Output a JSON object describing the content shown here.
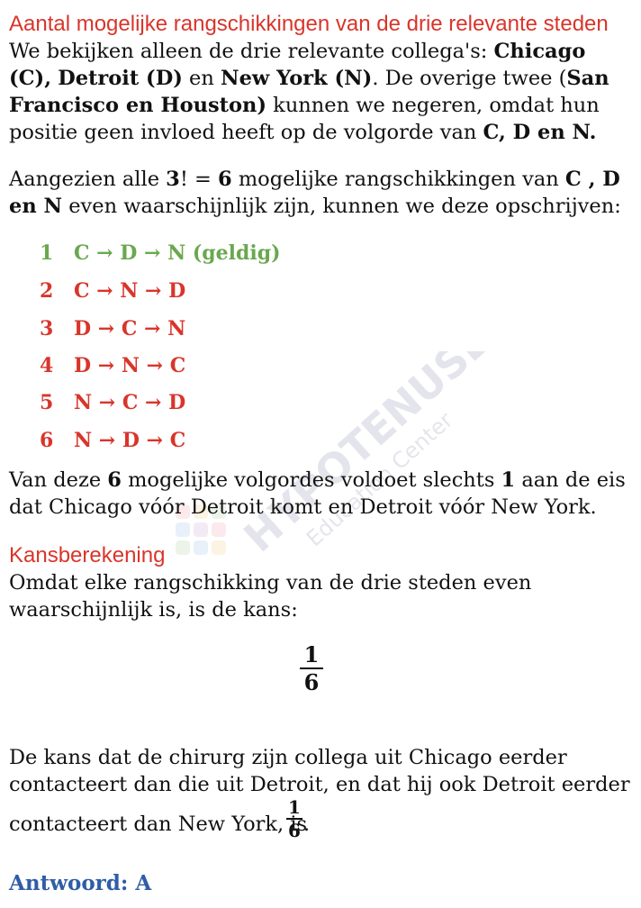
{
  "section1": {
    "heading": "Aantal mogelijke rangschikkingen van de drie relevante steden",
    "p1_a": "We bekijken alleen de drie relevante collega's: ",
    "p1_b": "Chicago (C),",
    "p1_c": "Detroit (D)",
    "p1_d": " en ",
    "p1_e": "New York (N)",
    "p1_f": ". De overige twee (",
    "p1_g": "San Francisco en Houston)",
    "p1_h": " kunnen we negeren, omdat hun positie geen invloed heeft op de volgorde van ",
    "p1_i": "C, D en N.",
    "p2_a": "Aangezien alle ",
    "p2_b": "3",
    "p2_c": "! = ",
    "p2_d": "6",
    "p2_e": " mogelijke rangschikkingen van ",
    "p2_f": "C , D en N",
    "p2_g": " even waarschijnlijk zijn, kunnen we deze opschrijven:"
  },
  "orderings": [
    {
      "num": "1",
      "text": "C → D → N (geldig)",
      "color": "#6aa84f"
    },
    {
      "num": "2",
      "text": "C → N → D",
      "color": "#d9352b"
    },
    {
      "num": "3",
      "text": "D → C → N",
      "color": "#d9352b"
    },
    {
      "num": "4",
      "text": "D → N → C",
      "color": "#d9352b"
    },
    {
      "num": "5",
      "text": "N → C → D",
      "color": "#d9352b"
    },
    {
      "num": "6",
      "text": "N → D → C",
      "color": "#d9352b"
    }
  ],
  "summary": {
    "a": "Van deze ",
    "b": "6",
    "c": " mogelijke volgordes voldoet slechts ",
    "d": "1",
    "e": " aan de eis dat Chicago vóór Detroit komt en Detroit vóór New York."
  },
  "section2": {
    "heading": "Kansberekening",
    "p1": "Omdat elke rangschikking van de drie steden even waarschijnlijk is, is de kans:",
    "frac_num": "1",
    "frac_den": "6",
    "p2_a": "De kans dat de chirurg zijn collega uit Chicago eerder contacteert dan die uit Detroit, en dat hij ook Detroit eerder",
    "p2_b": "contacteert dan New York, is ",
    "inline_num": "1",
    "inline_den": "6",
    "p2_end": "."
  },
  "answer": "Antwoord: A",
  "watermark": {
    "brand": "HYPOTENUSE",
    "sub": "Education Center"
  },
  "colors": {
    "heading": "#d9352b",
    "valid": "#6aa84f",
    "invalid": "#d9352b",
    "answer": "#2f5da6"
  }
}
